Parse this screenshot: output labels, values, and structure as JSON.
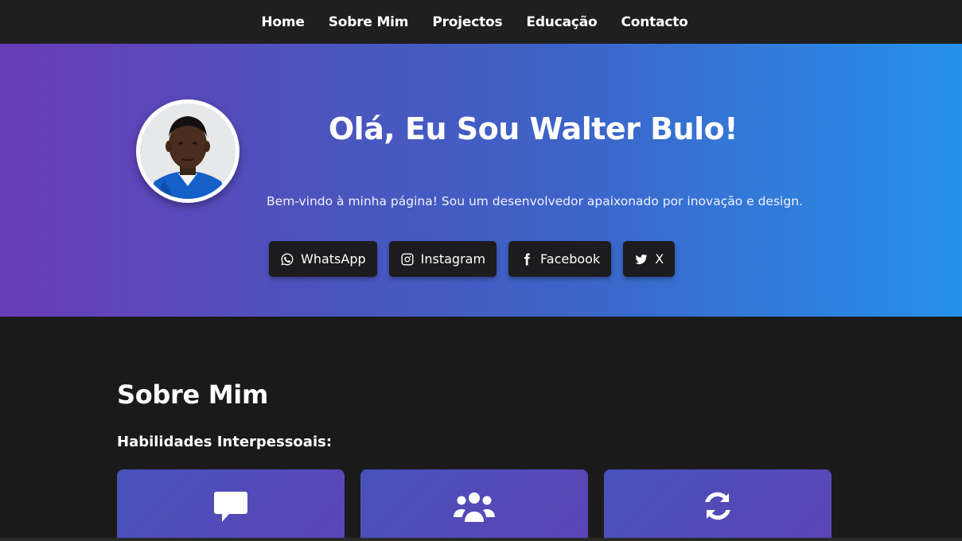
{
  "nav": {
    "items": [
      "Home",
      "Sobre Mim",
      "Projectos",
      "Educação",
      "Contacto"
    ]
  },
  "hero": {
    "title": "Olá, Eu Sou Walter Bulo!",
    "subtitle": "Bem-vindo à minha página! Sou um desenvolvedor apaixonado por inovação e design.",
    "socials": [
      {
        "label": "WhatsApp",
        "icon": "whatsapp-icon"
      },
      {
        "label": "Instagram",
        "icon": "instagram-icon"
      },
      {
        "label": "Facebook",
        "icon": "facebook-icon"
      },
      {
        "label": "X",
        "icon": "twitter-icon"
      }
    ]
  },
  "about": {
    "title": "Sobre Mim",
    "skills_title": "Habilidades Interpessoais:",
    "cards": [
      {
        "icon": "comment-icon"
      },
      {
        "icon": "users-icon"
      },
      {
        "icon": "sync-icon"
      }
    ]
  },
  "colors": {
    "nav_bg": "#1f1f1f",
    "hero_gradient_start": "#6a3bb8",
    "hero_gradient_end": "#2591ea",
    "page_bg": "#1a1a1b",
    "button_bg": "#1c1c1e",
    "card_bg": "#4f4cb8"
  }
}
